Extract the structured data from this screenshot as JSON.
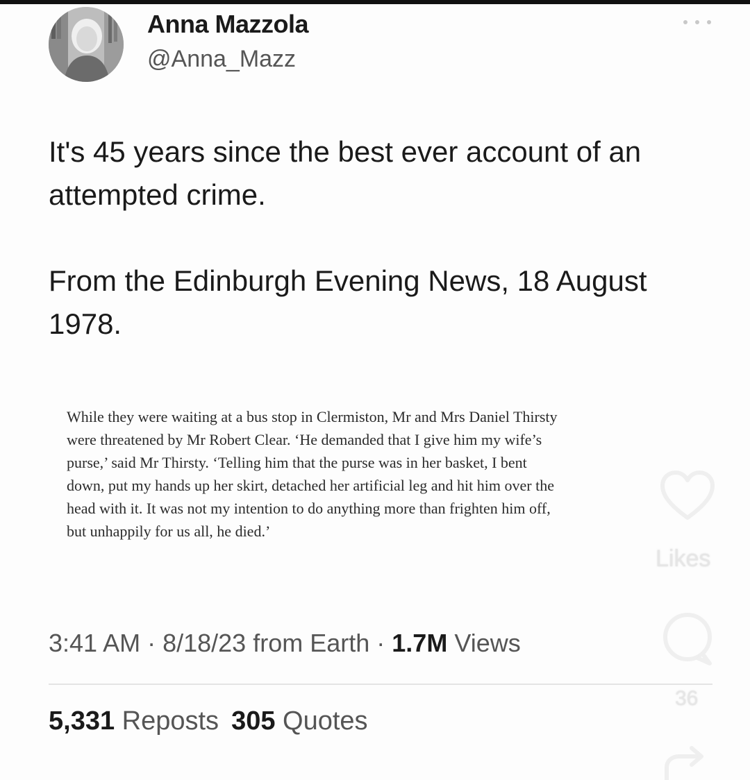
{
  "author": {
    "display_name": "Anna Mazzola",
    "handle": "@Anna_Mazz"
  },
  "tweet": {
    "paragraphs": [
      "It's 45 years since the best ever account of an attempted crime.",
      "From the Edinburgh Evening News, 18 August 1978."
    ]
  },
  "news_clip": {
    "lines": [
      "While they were waiting at a bus stop in Clermiston, Mr and Mrs Daniel Thirsty",
      "were threatened by Mr Robert Clear. ‘He demanded that I give him my wife’s",
      "purse,’ said Mr Thirsty. ‘Telling him that the purse was in her basket, I bent",
      "down, put my hands up her skirt, detached her artificial leg and hit him over the",
      "head with it. It was not my intention to do anything more than frighten him off,",
      "but unhappily for us all, he died.’"
    ]
  },
  "meta": {
    "time": "3:41 AM",
    "sep1": " · ",
    "date": "8/18/23",
    "source": " from Earth",
    "sep2": " · ",
    "views_count": "1.7M",
    "views_label": " Views"
  },
  "stats": {
    "reposts_count": "5,331",
    "reposts_label": " Reposts",
    "quotes_count": "305",
    "quotes_label": " Quotes"
  },
  "overlay": {
    "likes_label": "Likes",
    "comment_count": "36"
  },
  "icons": {
    "more": "more-dots-icon",
    "like": "heart-icon",
    "comment": "comment-icon",
    "share": "share-icon"
  }
}
